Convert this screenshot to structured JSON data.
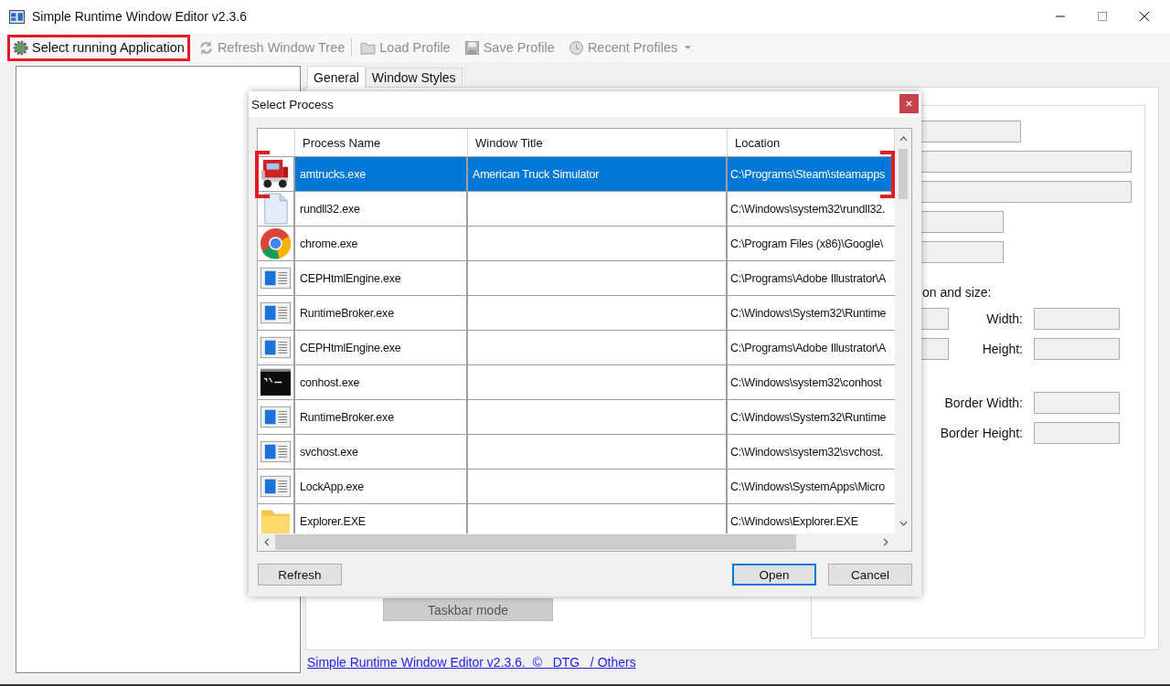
{
  "window": {
    "title": "Simple Runtime Window Editor v2.3.6"
  },
  "toolbar": [
    {
      "kind": "gear",
      "label": "Select running Application",
      "disabled": false,
      "highlighted": true
    },
    {
      "kind": "refresh",
      "label": "Refresh Window Tree",
      "disabled": true,
      "highlighted": false
    },
    {
      "kind": "folder",
      "label": "Load Profile",
      "disabled": true,
      "highlighted": false
    },
    {
      "kind": "save",
      "label": "Save Profile",
      "disabled": true,
      "highlighted": false
    },
    {
      "kind": "clock",
      "label": "Recent Profiles",
      "disabled": true,
      "highlighted": false,
      "dropdown": true
    }
  ],
  "tabs": [
    {
      "label": "General",
      "selected": true
    },
    {
      "label": "Window Styles",
      "selected": false
    }
  ],
  "position_label": "on and size:",
  "size_fields": [
    {
      "label": "Width:"
    },
    {
      "label": "Height:"
    }
  ],
  "border_fields": [
    {
      "label": "Border Width:"
    },
    {
      "label": "Border Height:"
    }
  ],
  "taskbar_button": {
    "label": "Taskbar mode",
    "disabled": true
  },
  "footer_link": "Simple Runtime Window Editor v2.3.6.  ©   DTG   / Others",
  "dialog": {
    "title": "Select Process",
    "columns": [
      "Process Name",
      "Window Title",
      "Location"
    ],
    "rows": [
      {
        "kind": "truck",
        "name": "amtrucks.exe",
        "title": "American Truck Simulator",
        "location": "C:\\Programs\\Steam\\steamapps",
        "selected": true,
        "highlighted": true
      },
      {
        "kind": "file",
        "name": "rundll32.exe",
        "location": "C:\\Windows\\system32\\rundll32.",
        "selected": false,
        "highlighted": false
      },
      {
        "kind": "browser",
        "name": "chrome.exe",
        "location": "C:\\Program Files (x86)\\Google\\",
        "selected": false,
        "highlighted": false
      },
      {
        "kind": "window",
        "name": "CEPHtmlEngine.exe",
        "location": "C:\\Programs\\Adobe Illustrator\\A",
        "selected": false,
        "highlighted": false
      },
      {
        "kind": "window",
        "name": "RuntimeBroker.exe",
        "location": "C:\\Windows\\System32\\Runtime",
        "selected": false,
        "highlighted": false
      },
      {
        "kind": "window",
        "name": "CEPHtmlEngine.exe",
        "location": "C:\\Programs\\Adobe Illustrator\\A",
        "selected": false,
        "highlighted": false
      },
      {
        "kind": "console",
        "name": "conhost.exe",
        "location": "C:\\Windows\\system32\\conhost",
        "selected": false,
        "highlighted": false
      },
      {
        "kind": "window",
        "name": "RuntimeBroker.exe",
        "location": "C:\\Windows\\System32\\Runtime",
        "selected": false,
        "highlighted": false
      },
      {
        "kind": "window",
        "name": "svchost.exe",
        "location": "C:\\Windows\\system32\\svchost.",
        "selected": false,
        "highlighted": false
      },
      {
        "kind": "window",
        "name": "LockApp.exe",
        "location": "C:\\Windows\\SystemApps\\Micro",
        "selected": false,
        "highlighted": false
      },
      {
        "kind": "folder",
        "name": "Explorer.EXE",
        "location": "C:\\Windows\\Explorer.EXE",
        "selected": false,
        "highlighted": false
      }
    ],
    "buttons": [
      {
        "label": "Refresh",
        "default": false
      },
      {
        "label": "Open",
        "default": true
      },
      {
        "label": "Cancel",
        "default": false
      }
    ]
  }
}
